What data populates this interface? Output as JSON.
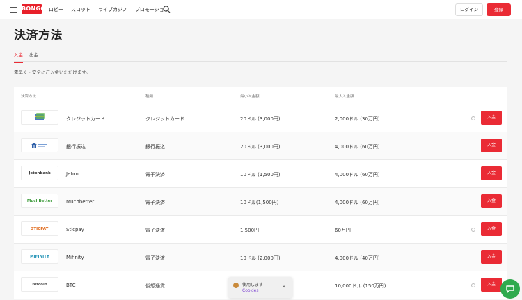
{
  "header": {
    "logo_text": "BONGO!",
    "nav": [
      "ロビー",
      "スロット",
      "ライブカジノ",
      "プロモーション"
    ],
    "login_label": "ログイン",
    "register_label": "登録"
  },
  "page": {
    "title": "決済方法",
    "tabs": [
      "入金",
      "出金"
    ],
    "active_tab": "入金",
    "subtitle": "素早く・安全にご入金いただけます。"
  },
  "table": {
    "headers": [
      "決済方法",
      "種類",
      "最小入金額",
      "最大入金額"
    ],
    "rows": [
      {
        "logo": "card",
        "name": "クレジットカード",
        "type": "クレジットカード",
        "min": "20ドル (3,000円)",
        "max": "2,000ドル (30万円)",
        "info": true,
        "button": "入金"
      },
      {
        "logo": "bank",
        "name": "銀行振込",
        "type": "銀行振込",
        "min": "20ドル (3,000円)",
        "max": "4,000ドル (60万円)",
        "info": false,
        "button": "入金"
      },
      {
        "logo": "Jetonbank",
        "name": "Jeton",
        "type": "電子決済",
        "min": "10ドル (1,500円)",
        "max": "4,000ドル (60万円)",
        "info": false,
        "button": "入金"
      },
      {
        "logo": "MuchBetter",
        "name": "Muchbetter",
        "type": "電子決済",
        "min": "10ドル(1,500円)",
        "max": "4,000ドル (60万円)",
        "info": false,
        "button": "入金"
      },
      {
        "logo": "STICPAY",
        "name": "Sticpay",
        "type": "電子決済",
        "min": "1,500円",
        "max": "60万円",
        "info": true,
        "button": "入金"
      },
      {
        "logo": "MIFINITY",
        "name": "Mifinity",
        "type": "電子決済",
        "min": "10ドル (2,000円)",
        "max": "4,000ドル (40万円)",
        "info": false,
        "button": "入金"
      },
      {
        "logo": "Bitcoin",
        "name": "BTC",
        "type": "仮想通貨",
        "min": "",
        "max": "10,000ドル (150万円)",
        "info": true,
        "button": "入金"
      }
    ]
  },
  "cookie": {
    "text": "使用します",
    "link": "Cookies",
    "close": "×"
  },
  "colors": {
    "accent": "#ea2b35",
    "chat": "#2faa4e"
  }
}
